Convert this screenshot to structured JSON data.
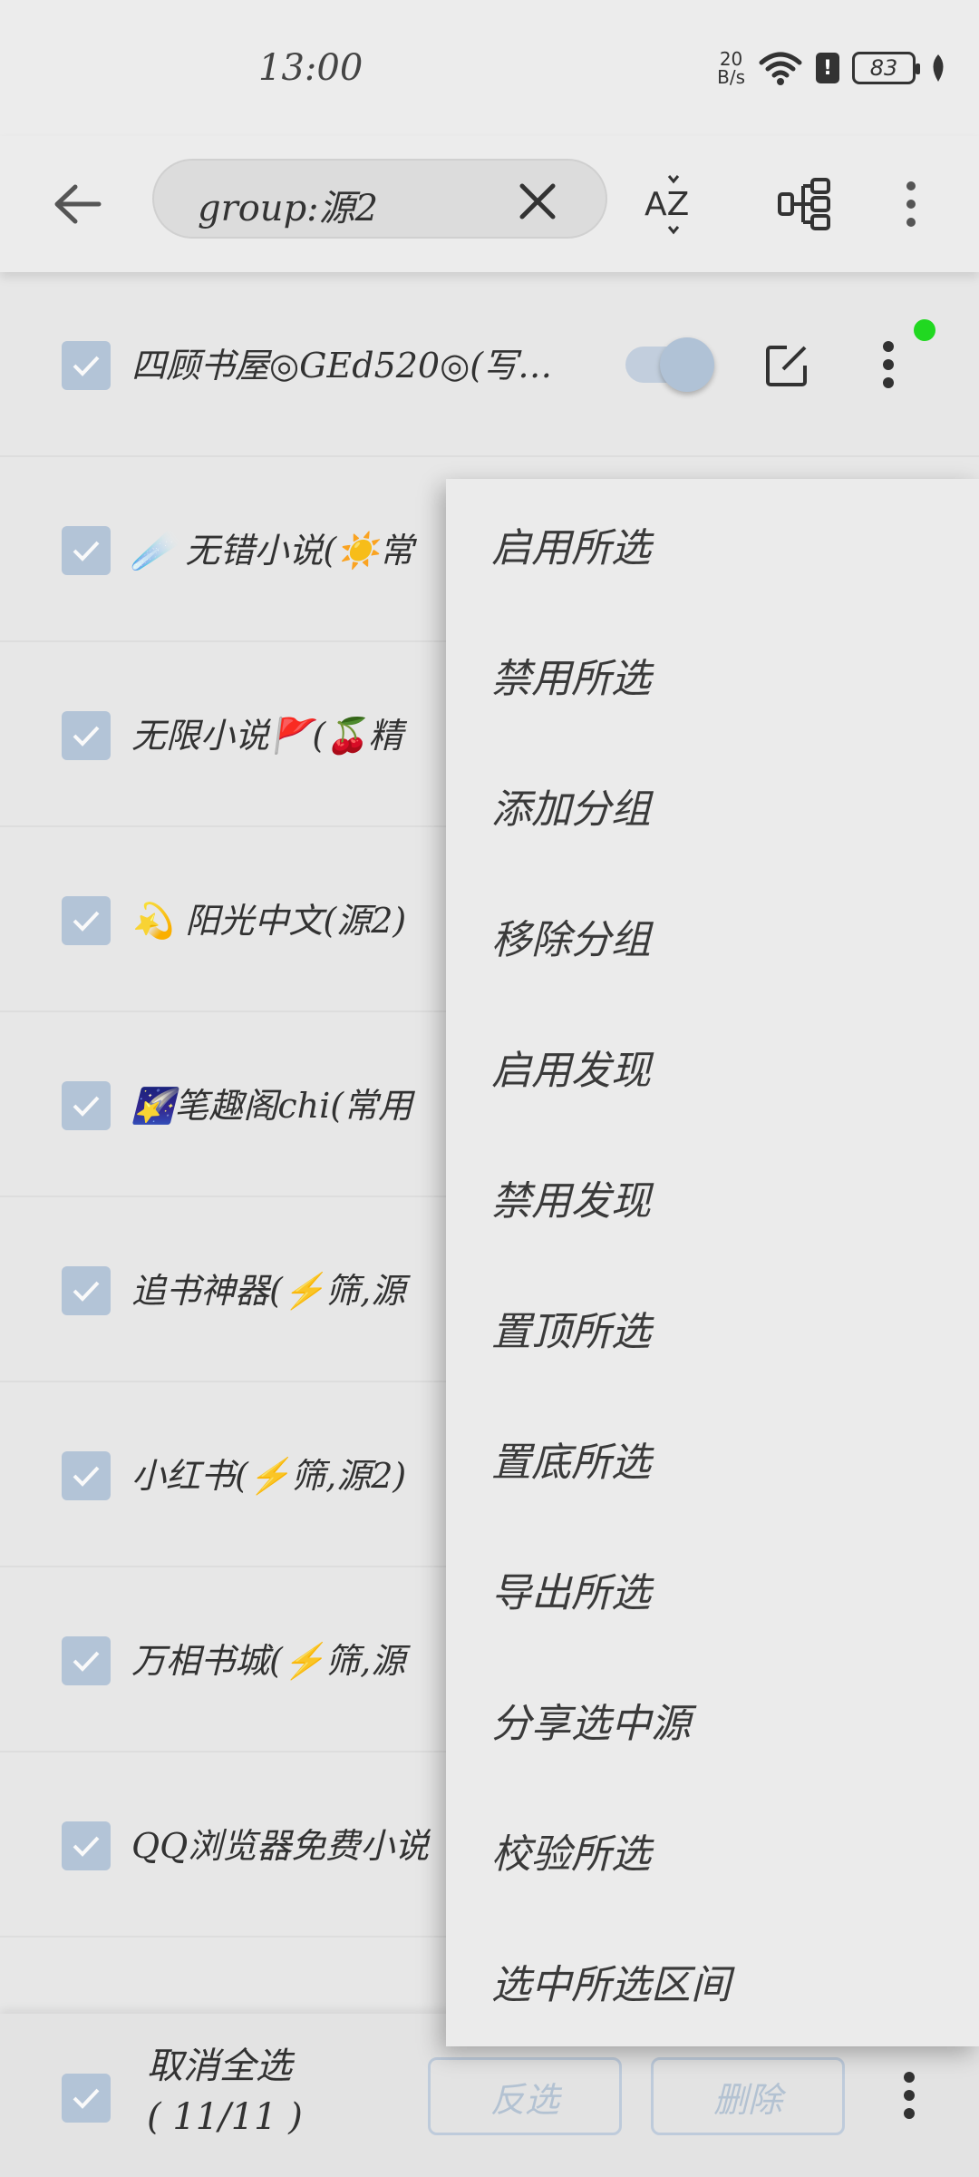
{
  "status_bar": {
    "time": "13:00",
    "net_speed_value": "20",
    "net_speed_unit": "B/s",
    "battery": "83"
  },
  "toolbar": {
    "search_value": "group:源2",
    "sort_icon_label": "AZ"
  },
  "list": {
    "items": [
      {
        "label": "四顾书屋◎GEd520◎(写…",
        "enabled": true
      },
      {
        "label": "☄️ 无错小说(☀️常"
      },
      {
        "label": "无限小说🚩(🍒精"
      },
      {
        "label": "💫 阳光中文(源2)"
      },
      {
        "label": "🌠笔趣阁chi(常用"
      },
      {
        "label": "追书神器(⚡筛,源"
      },
      {
        "label": "小红书(⚡筛,源2)"
      },
      {
        "label": "万相书城(⚡筛,源"
      },
      {
        "label": "QQ浏览器免费小说"
      }
    ]
  },
  "popup_menu": {
    "items": [
      "启用所选",
      "禁用所选",
      "添加分组",
      "移除分组",
      "启用发现",
      "禁用发现",
      "置顶所选",
      "置底所选",
      "导出所选",
      "分享选中源",
      "校验所选",
      "选中所选区间"
    ]
  },
  "bottom_bar": {
    "select_all_label": "取消全选",
    "select_count": "( 11/11 )",
    "invert_label": "反选",
    "delete_label": "删除"
  },
  "colors": {
    "accent": "#b7c8dc",
    "status_dot": "#22dd22",
    "background": "#ececec"
  }
}
